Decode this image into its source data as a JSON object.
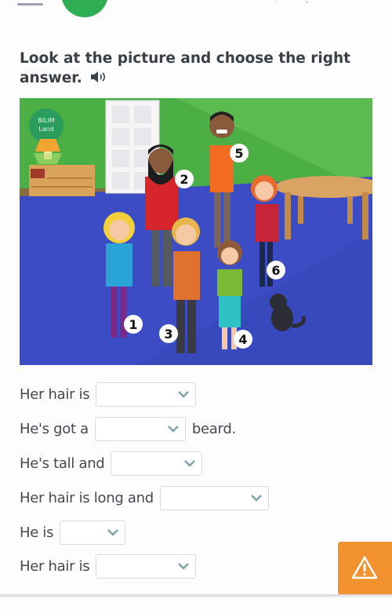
{
  "header": {
    "menu_icon": "hamburger-menu-icon",
    "home_button_color": "#2fae55"
  },
  "task": {
    "instruction": "Look at the picture and choose the right answer.",
    "audio_icon": "speaker-icon"
  },
  "picture": {
    "logo_line1": "BILIM",
    "logo_line2": "Land",
    "labels": [
      "1",
      "2",
      "3",
      "4",
      "5",
      "6"
    ]
  },
  "questions": [
    {
      "prefix": "Her hair is",
      "selected": "",
      "suffix": ""
    },
    {
      "prefix": "He's got a",
      "selected": "",
      "suffix": "beard."
    },
    {
      "prefix": "He's tall and",
      "selected": "",
      "suffix": ""
    },
    {
      "prefix": "Her hair is long and",
      "selected": "",
      "suffix": ""
    },
    {
      "prefix": "He is",
      "selected": "",
      "suffix": ""
    },
    {
      "prefix": "Her hair is",
      "selected": "",
      "suffix": ""
    }
  ],
  "report_button": {
    "icon": "warning-icon",
    "color": "#f2922e"
  }
}
